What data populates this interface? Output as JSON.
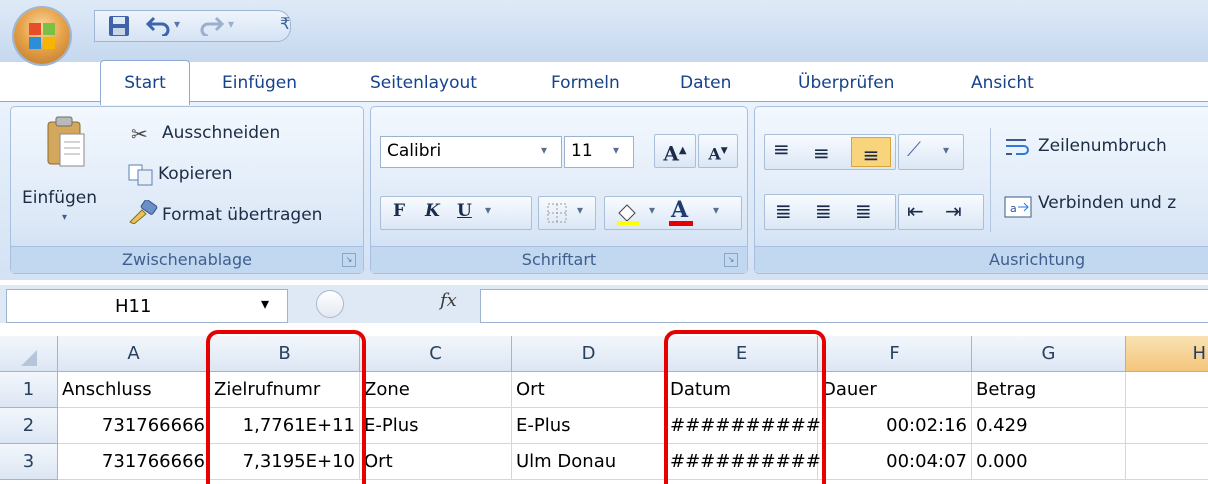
{
  "qat": {
    "save_icon": "save-icon",
    "undo_icon": "undo-icon",
    "redo_icon": "redo-icon",
    "customize_icon": "customize-qat-icon"
  },
  "tabs": [
    "Start",
    "Einfügen",
    "Seitenlayout",
    "Formeln",
    "Daten",
    "Überprüfen",
    "Ansicht"
  ],
  "clipboard": {
    "paste_label": "Einfügen",
    "cut_label": "Ausschneiden",
    "copy_label": "Kopieren",
    "format_label": "Format übertragen",
    "group_label": "Zwischenablage"
  },
  "font": {
    "family": "Calibri",
    "size": "11",
    "grow": "A",
    "shrink": "A",
    "bold": "F",
    "italic": "K",
    "underline": "U",
    "font_color": "A",
    "group_label": "Schriftart"
  },
  "alignment": {
    "wrap_label": "Zeilenumbruch",
    "merge_label": "Verbinden und z",
    "group_label": "Ausrichtung"
  },
  "formula_bar": {
    "name_box": "H11",
    "fx": "fx",
    "value": ""
  },
  "sheet": {
    "columns": [
      "A",
      "B",
      "C",
      "D",
      "E",
      "F",
      "G",
      "H"
    ],
    "rows": [
      {
        "num": "1",
        "cells": [
          "Anschluss",
          "Zielrufnumr",
          "Zone",
          "Ort",
          "Datum",
          "Dauer",
          "Betrag",
          ""
        ]
      },
      {
        "num": "2",
        "cells": [
          "731766666",
          "1,7761E+11",
          "E-Plus",
          "E-Plus",
          "##########",
          "00:02:16",
          "0.429",
          ""
        ]
      },
      {
        "num": "3",
        "cells": [
          "731766666",
          "7,3195E+10",
          "Ort",
          "Ulm Donau",
          "##########",
          "00:04:07",
          "0.000",
          ""
        ]
      }
    ]
  },
  "colors": {
    "highlight": "#e60000",
    "ribbon_text": "#15428b"
  }
}
